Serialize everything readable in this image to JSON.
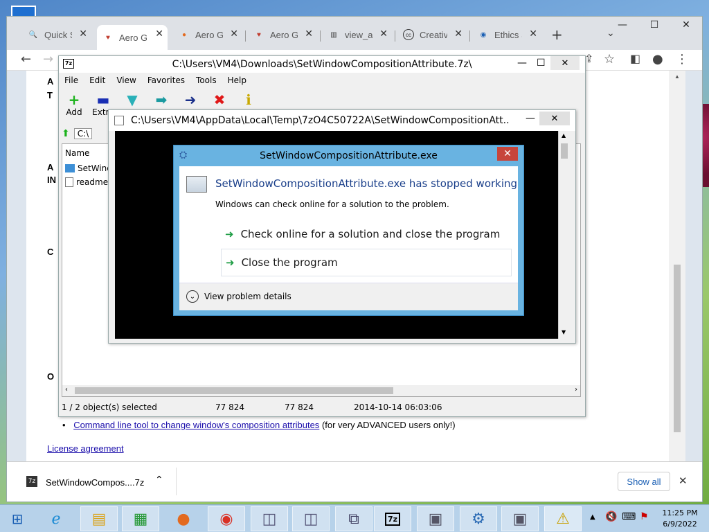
{
  "browser": {
    "tabs": [
      {
        "label": "Quick Se",
        "icon": "search-icon"
      },
      {
        "label": "Aero Gla",
        "icon": "aero-favicon"
      },
      {
        "label": "Aero Gla",
        "icon": "firefox-favicon"
      },
      {
        "label": "Aero Gla",
        "icon": "aero-favicon"
      },
      {
        "label": "view_arc",
        "icon": "archive-favicon"
      },
      {
        "label": "Creative",
        "icon": "cc-favicon"
      },
      {
        "label": "Ethics Sti",
        "icon": "ethics-favicon"
      }
    ],
    "page": {
      "heading_letters": [
        "A",
        "T",
        "A",
        "IN",
        "C",
        "O"
      ],
      "link_command_line": "Command line tool to change window's composition attributes",
      "link_command_line_suffix": "(for very ADVANCED users only!)",
      "link_license": "License agreement"
    },
    "download": {
      "filename": "SetWindowCompos....7z",
      "show_all": "Show all"
    }
  },
  "sevenzip": {
    "title": "C:\\Users\\VM4\\Downloads\\SetWindowCompositionAttribute.7z\\",
    "menu": [
      "File",
      "Edit",
      "View",
      "Favorites",
      "Tools",
      "Help"
    ],
    "tools": [
      {
        "label": "Add",
        "glyph": "+"
      },
      {
        "label": "Extra",
        "glyph": "▬"
      },
      {
        "label": "",
        "glyph": "▼"
      },
      {
        "label": "",
        "glyph": "➡"
      },
      {
        "label": "",
        "glyph": "➜"
      },
      {
        "label": "",
        "glyph": "✖"
      },
      {
        "label": "",
        "glyph": "ℹ"
      }
    ],
    "path_prefix": "C:\\",
    "column_name": "Name",
    "files": [
      "SetWindo",
      "readme.t"
    ],
    "status": {
      "selected": "1 / 2 object(s) selected",
      "size": "77 824",
      "packed": "77 824",
      "modified": "2014-10-14 06:03:06"
    }
  },
  "dark_window": {
    "title": "C:\\Users\\VM4\\AppData\\Local\\Temp\\7zO4C50722A\\SetWindowCompositionAtt..."
  },
  "error_dialog": {
    "title": "SetWindowCompositionAttribute.exe",
    "heading": "SetWindowCompositionAttribute.exe has stopped working",
    "message": "Windows can check online for a solution to the problem.",
    "option_1": "Check online for a solution and close the program",
    "option_2": "Close the program",
    "details": "View problem details"
  },
  "taskbar": {
    "time": "11:25 PM",
    "date": "6/9/2022"
  },
  "colors": {
    "link": "#1a0dab",
    "dialog_frame": "#69b3e1",
    "close_red": "#c7453b",
    "arrow_green": "#1f9d45"
  }
}
